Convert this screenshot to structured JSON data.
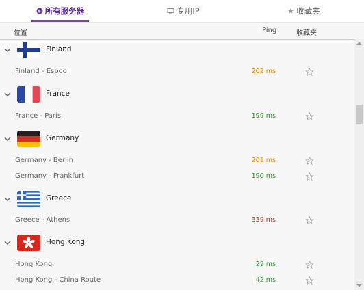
{
  "tabs": [
    {
      "label": "所有服务器",
      "icon": "globe-icon",
      "active": true
    },
    {
      "label": "专用IP",
      "icon": "monitor-icon",
      "active": false
    },
    {
      "label": "收藏夹",
      "icon": "star-icon",
      "active": false
    }
  ],
  "columns": {
    "location": "位置",
    "ping": "Ping",
    "favorites": "收藏夹"
  },
  "colors": {
    "accent": "#7a3fb0",
    "ping_medium": "#e08a00",
    "ping_good": "#2a9a2a",
    "ping_bad": "#c0392b"
  },
  "countries": [
    {
      "name": "Finland",
      "flag": "finland-flag",
      "servers": [
        {
          "name": "Finland - Espoo",
          "ping": "202 ms",
          "level": "medium"
        }
      ]
    },
    {
      "name": "France",
      "flag": "france-flag",
      "servers": [
        {
          "name": "France - Paris",
          "ping": "199 ms",
          "level": "good"
        }
      ]
    },
    {
      "name": "Germany",
      "flag": "germany-flag",
      "servers": [
        {
          "name": "Germany - Berlin",
          "ping": "201 ms",
          "level": "medium"
        },
        {
          "name": "Germany - Frankfurt",
          "ping": "190 ms",
          "level": "good"
        }
      ]
    },
    {
      "name": "Greece",
      "flag": "greece-flag",
      "servers": [
        {
          "name": "Greece - Athens",
          "ping": "339 ms",
          "level": "bad"
        }
      ]
    },
    {
      "name": "Hong Kong",
      "flag": "hong-kong-flag",
      "servers": [
        {
          "name": "Hong Kong",
          "ping": "29 ms",
          "level": "good"
        },
        {
          "name": "Hong Kong - China Route",
          "ping": "42 ms",
          "level": "good"
        }
      ]
    }
  ]
}
